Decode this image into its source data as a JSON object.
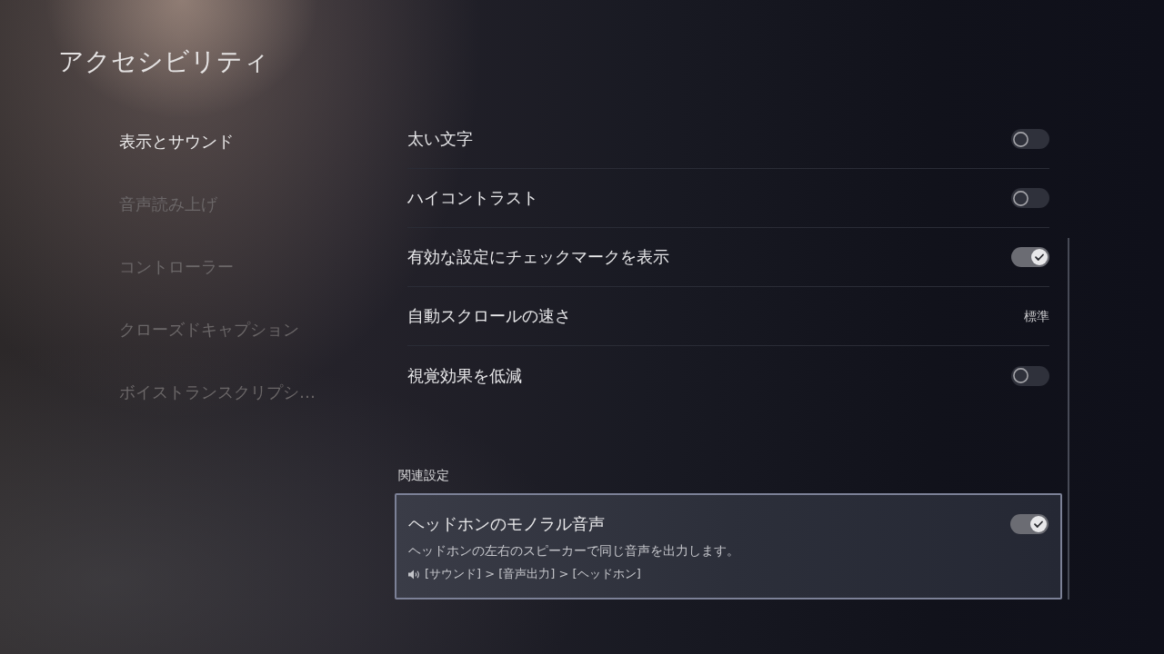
{
  "page": {
    "title": "アクセシビリティ"
  },
  "sidebar": {
    "items": [
      {
        "label": "表示とサウンド",
        "selected": true
      },
      {
        "label": "音声読み上げ",
        "selected": false
      },
      {
        "label": "コントローラー",
        "selected": false
      },
      {
        "label": "クローズドキャプション",
        "selected": false
      },
      {
        "label": "ボイストランスクリプシ…",
        "selected": false
      }
    ]
  },
  "settings": [
    {
      "kind": "toggle",
      "label": "太い文字",
      "on": false
    },
    {
      "kind": "toggle",
      "label": "ハイコントラスト",
      "on": false
    },
    {
      "kind": "toggle",
      "label": "有効な設定にチェックマークを表示",
      "on": true
    },
    {
      "kind": "value",
      "label": "自動スクロールの速さ",
      "value": "標準"
    },
    {
      "kind": "toggle",
      "label": "視覚効果を低減",
      "on": false
    }
  ],
  "related": {
    "heading": "関連設定",
    "items": [
      {
        "label": "ヘッドホンのモノラル音声",
        "on": true,
        "selected": true,
        "description": "ヘッドホンの左右のスピーカーで同じ音声を出力します。",
        "path": "[サウンド] > [音声出力] > [ヘッドホン]"
      }
    ]
  }
}
